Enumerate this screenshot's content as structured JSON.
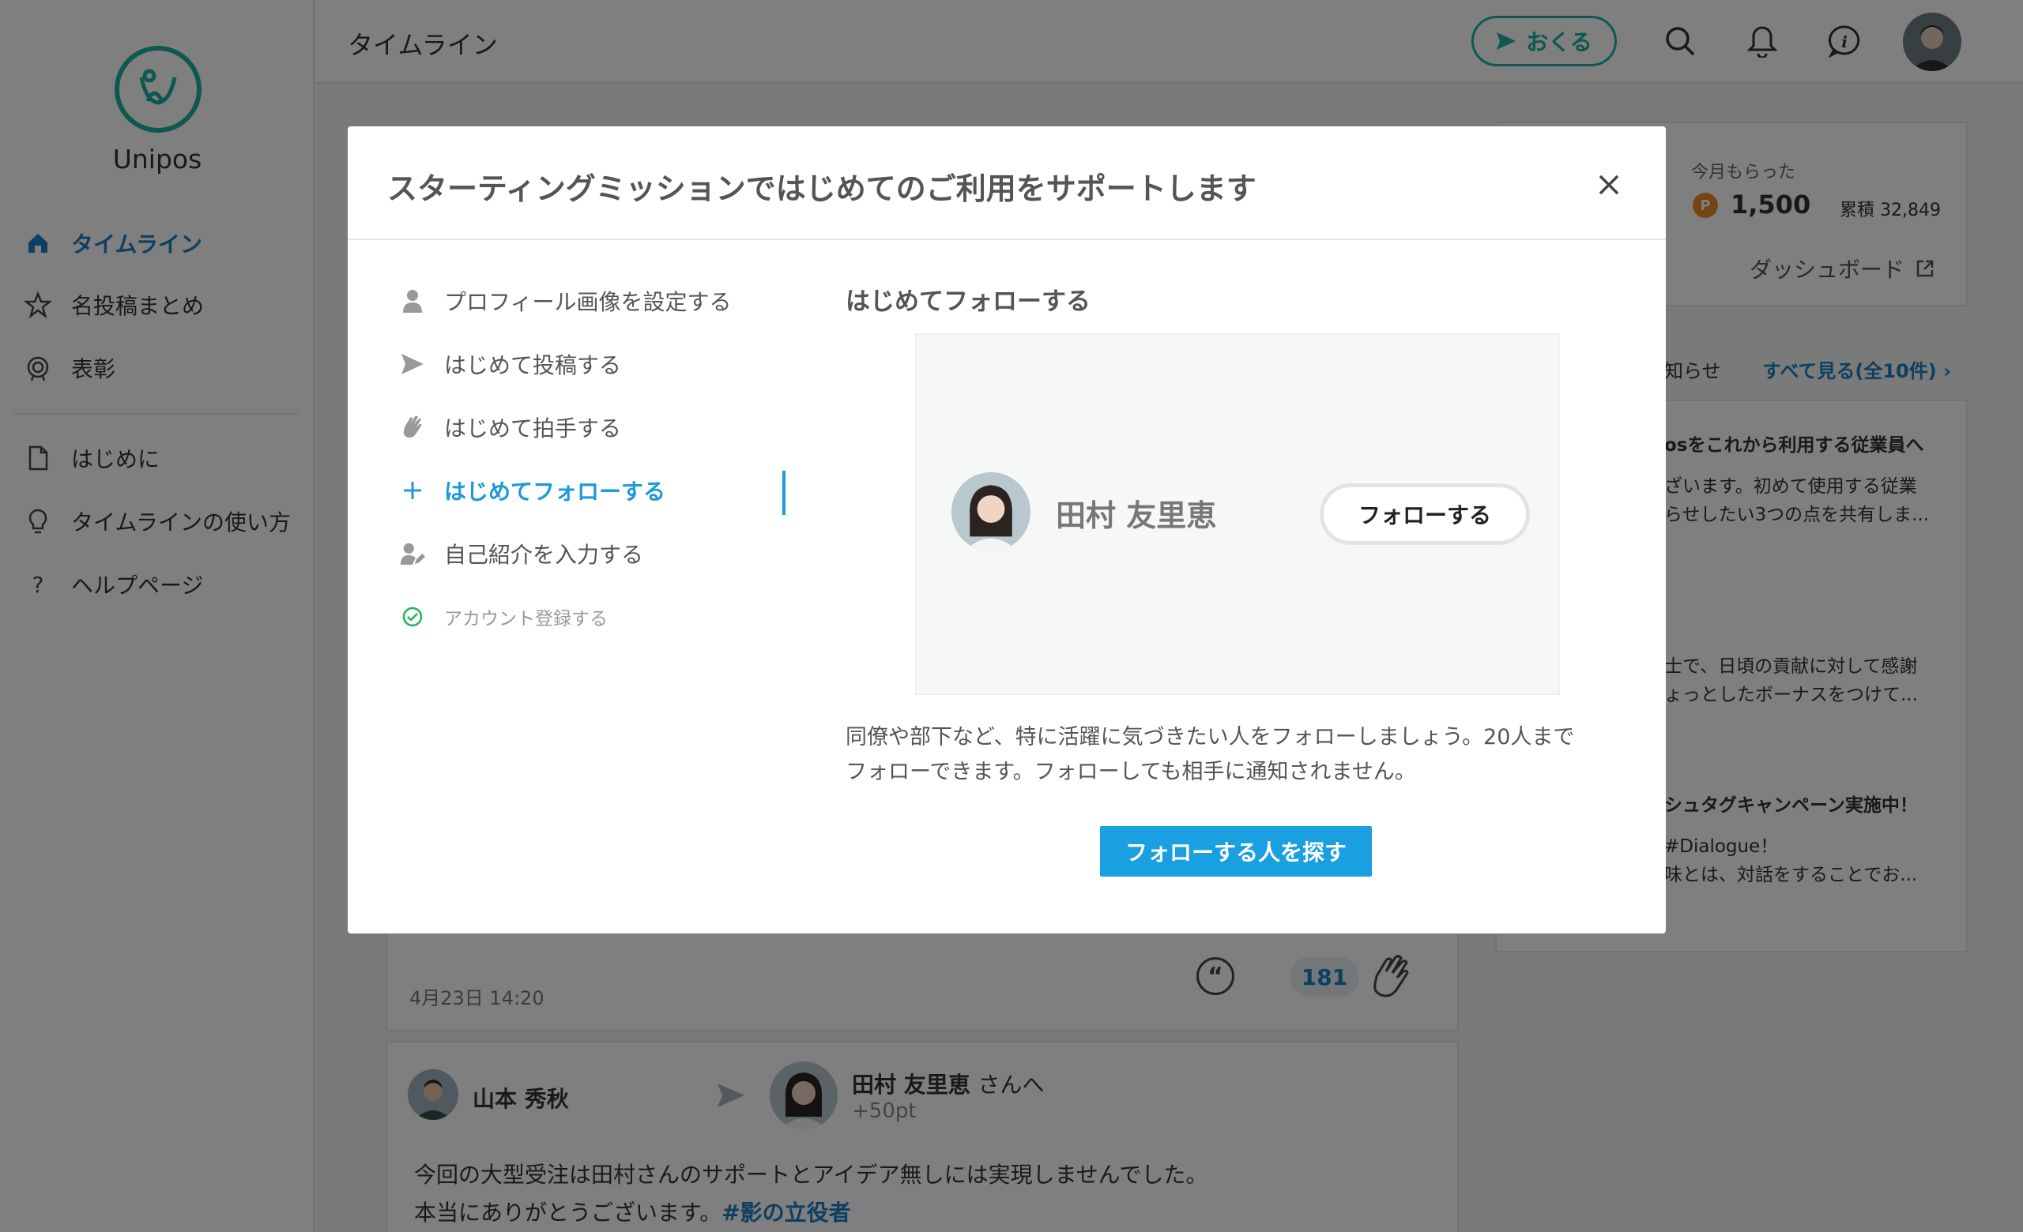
{
  "sidebar": {
    "logo_text": "Unipos",
    "items": [
      {
        "label": "タイムライン"
      },
      {
        "label": "名投稿まとめ"
      },
      {
        "label": "表彰"
      },
      {
        "label": "はじめに"
      },
      {
        "label": "タイムラインの使い方"
      },
      {
        "label": "ヘルプページ"
      }
    ]
  },
  "header": {
    "title": "タイムライン",
    "send_label": "おくる"
  },
  "feed": {
    "post1": {
      "timestamp": "4月23日 14:20",
      "clap_count": "181"
    },
    "post2": {
      "sender": "山本 秀秋",
      "recipient": "田村 友里恵",
      "recipient_suffix": "さんへ",
      "points": "+50pt",
      "line1": "今回の大型受注は田村さんのサポートとアイデア無しには実現しませんでした。",
      "line2": "本当にありがとうございます。",
      "hashtag": "#影の立役者"
    }
  },
  "right_panel": {
    "received_label": "今月もらった",
    "points": "1,500",
    "total": "累積 32,849",
    "dashboard_label": "ダッシュボード",
    "news_head": "知らせ",
    "news_all": "すべて見る(全10件)",
    "news": [
      {
        "title": "osをこれから利用する従業員へ",
        "line1": "ざいます。初めて使用する従業",
        "line2": "らせしたい3つの点を共有しま..."
      },
      {
        "line1": "士で、日頃の貢献に対して感謝",
        "line2": "ょっとしたボーナスをつけて..."
      },
      {
        "title": "シュタグキャンペーン実施中！",
        "line1": "#Dialogue！",
        "line2": "味とは、対話をすることでお..."
      }
    ]
  },
  "modal": {
    "title": "スターティングミッションではじめてのご利用をサポートします",
    "steps": [
      {
        "label": "プロフィール画像を設定する",
        "state": "todo"
      },
      {
        "label": "はじめて投稿する",
        "state": "todo"
      },
      {
        "label": "はじめて拍手する",
        "state": "todo"
      },
      {
        "label": "はじめてフォローする",
        "state": "active"
      },
      {
        "label": "自己紹介を入力する",
        "state": "todo"
      },
      {
        "label": "アカウント登録する",
        "state": "done"
      }
    ],
    "panel_title": "はじめてフォローする",
    "preview_name": "田村 友里恵",
    "follow_label": "フォローする",
    "desc_line1": "同僚や部下など、特に活躍に気づきたい人をフォローしましょう。20人まで",
    "desc_line2": "フォローできます。フォローしても相手に通知されません。",
    "primary_label": "フォローする人を探す"
  },
  "colors": {
    "brand_teal": "#1ab0a0",
    "accent_blue": "#1d9ad8",
    "primary_button": "#1a9fe0",
    "point_orange": "#e8892a"
  }
}
